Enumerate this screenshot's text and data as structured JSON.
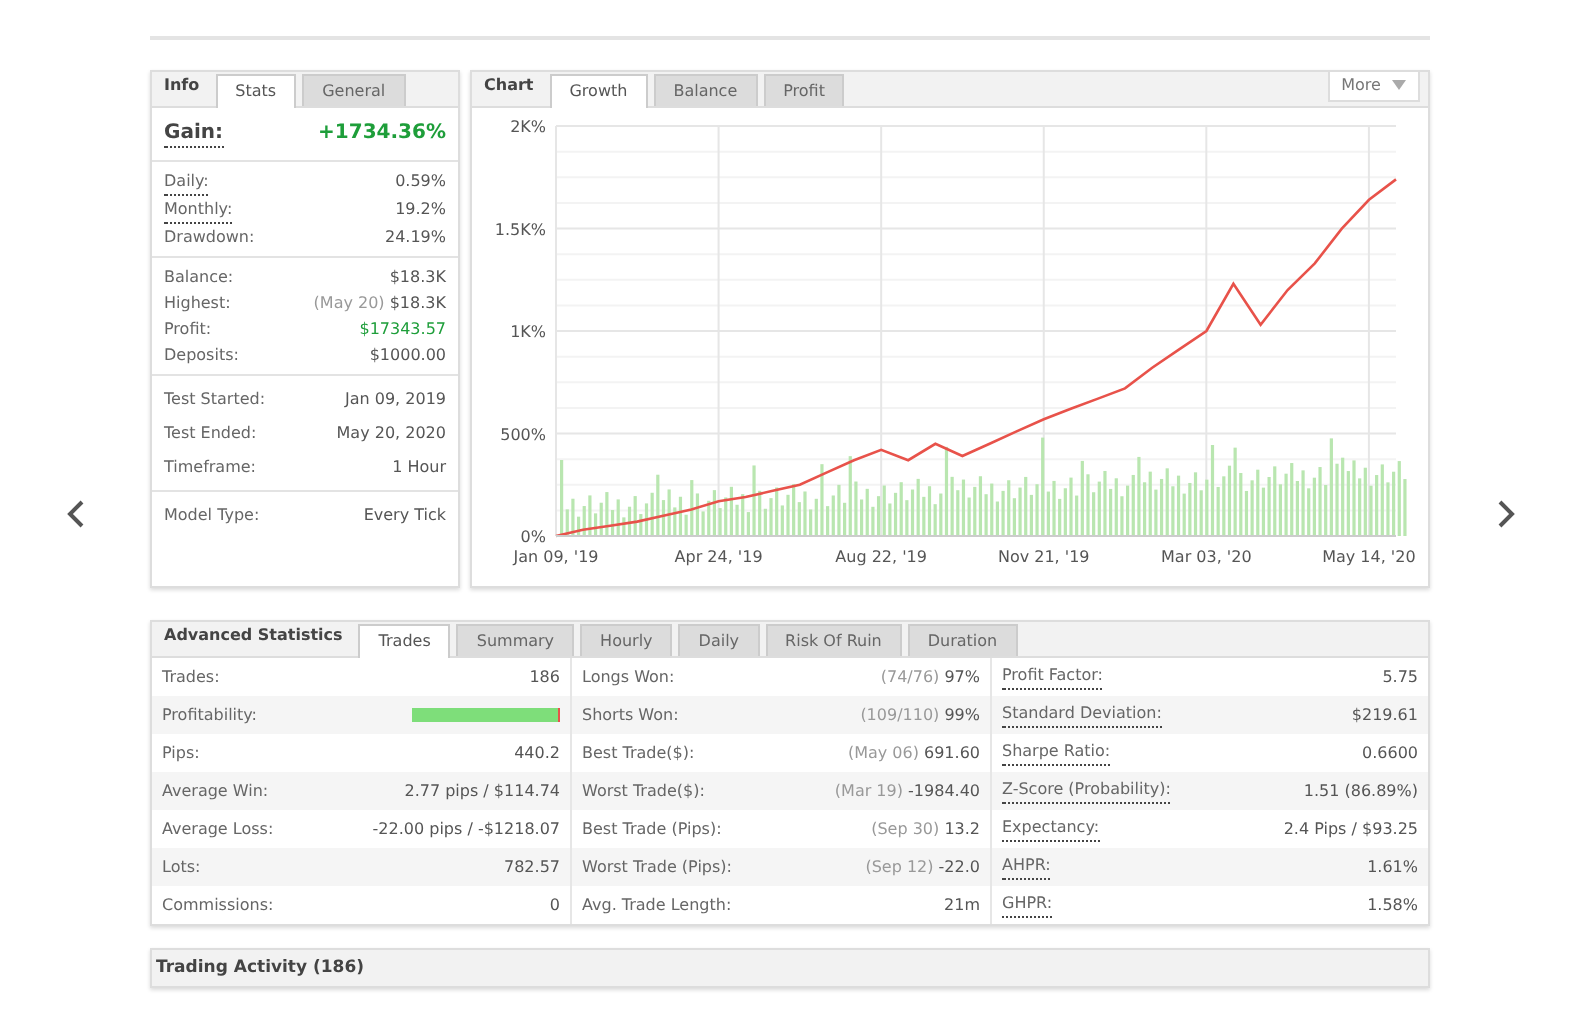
{
  "info": {
    "title": "Info",
    "tabs": [
      {
        "label": "Stats",
        "selected": true
      },
      {
        "label": "General",
        "selected": false
      }
    ],
    "gain": {
      "label": "Gain:",
      "value": "+1734.36%"
    },
    "groups": [
      [
        {
          "label": "Daily:",
          "value": "0.59%",
          "dotted": true,
          "kind": "plain"
        },
        {
          "label": "Monthly:",
          "value": "19.2%",
          "dotted": true,
          "kind": "plain"
        },
        {
          "label": "Drawdown:",
          "value": "24.19%",
          "dotted": false,
          "kind": "plain"
        }
      ],
      [
        {
          "label": "Balance:",
          "value": "$18.3K",
          "dotted": false,
          "kind": "plain"
        },
        {
          "label": "Highest:",
          "note": "(May 20)",
          "value": "$18.3K",
          "dotted": false,
          "kind": "plain"
        },
        {
          "label": "Profit:",
          "value": "$17343.57",
          "dotted": false,
          "kind": "positive"
        },
        {
          "label": "Deposits:",
          "value": "$1000.00",
          "dotted": false,
          "kind": "plain"
        }
      ],
      [
        {
          "label": "Test Started:",
          "value": "Jan 09, 2019",
          "dotted": false,
          "kind": "plain"
        },
        {
          "label": "Test Ended:",
          "value": "May 20, 2020",
          "dotted": false,
          "kind": "plain"
        },
        {
          "label": "Timeframe:",
          "value": "1 Hour",
          "dotted": false,
          "kind": "plain"
        }
      ],
      [
        {
          "label": "Model Type:",
          "value": "Every Tick",
          "dotted": false,
          "kind": "plain"
        }
      ]
    ]
  },
  "chart": {
    "title": "Chart",
    "tabs": [
      {
        "label": "Growth",
        "selected": true
      },
      {
        "label": "Balance",
        "selected": false
      },
      {
        "label": "Profit",
        "selected": false
      }
    ],
    "more": "More",
    "chart_data": {
      "type": "line",
      "grid": true,
      "ylim": [
        0,
        2000
      ],
      "categories": [
        "Jan 09, '19",
        null,
        null,
        null,
        null,
        null,
        "Apr 24, '19",
        null,
        null,
        null,
        null,
        null,
        "Aug 22, '19",
        null,
        null,
        null,
        null,
        null,
        "Nov 21, '19",
        null,
        null,
        null,
        null,
        null,
        "Mar 03, '20",
        null,
        null,
        null,
        null,
        null,
        "May 14, '20",
        null
      ],
      "yticks": [
        {
          "value": 0,
          "label": "0%"
        },
        {
          "value": 500,
          "label": "500%"
        },
        {
          "value": 1000,
          "label": "1K%"
        },
        {
          "value": 1500,
          "label": "1.5K%"
        },
        {
          "value": 2000,
          "label": "2K%"
        }
      ],
      "series": [
        {
          "color": "#e8524a",
          "values": [
            0,
            30,
            50,
            70,
            100,
            130,
            170,
            190,
            220,
            250,
            310,
            370,
            420,
            370,
            450,
            390,
            450,
            510,
            570,
            620,
            670,
            720,
            820,
            910,
            1000,
            1230,
            1030,
            1200,
            1330,
            1500,
            1640,
            1740
          ]
        }
      ]
    }
  },
  "advanced": {
    "title": "Advanced Statistics",
    "tabs": [
      {
        "label": "Trades",
        "selected": true
      },
      {
        "label": "Summary",
        "selected": false
      },
      {
        "label": "Hourly",
        "selected": false
      },
      {
        "label": "Daily",
        "selected": false
      },
      {
        "label": "Risk Of Ruin",
        "selected": false
      },
      {
        "label": "Duration",
        "selected": false
      }
    ],
    "columns": [
      [
        {
          "label": "Trades:",
          "value": "186",
          "kind": "text"
        },
        {
          "label": "Profitability:",
          "kind": "bar",
          "level": 0.984
        },
        {
          "label": "Pips:",
          "value": "440.2",
          "kind": "text"
        },
        {
          "label": "Average Win:",
          "value": "2.77 pips / $114.74",
          "kind": "text"
        },
        {
          "label": "Average Loss:",
          "value": "-22.00 pips / -$1218.07",
          "kind": "text"
        },
        {
          "label": "Lots:",
          "value": "782.57",
          "kind": "text"
        },
        {
          "label": "Commissions:",
          "value": "0",
          "kind": "text"
        }
      ],
      [
        {
          "label": "Longs Won:",
          "note": "(74/76)",
          "value": "97%",
          "kind": "text"
        },
        {
          "label": "Shorts Won:",
          "note": "(109/110)",
          "value": "99%",
          "kind": "text"
        },
        {
          "label": "Best Trade($):",
          "note": "(May 06)",
          "value": "691.60",
          "kind": "text"
        },
        {
          "label": "Worst Trade($):",
          "note": "(Mar 19)",
          "value": "-1984.40",
          "kind": "text"
        },
        {
          "label": "Best Trade (Pips):",
          "note": "(Sep 30)",
          "value": "13.2",
          "kind": "text"
        },
        {
          "label": "Worst Trade (Pips):",
          "note": "(Sep 12)",
          "value": "-22.0",
          "kind": "text"
        },
        {
          "label": "Avg. Trade Length:",
          "value": "21m",
          "kind": "text"
        }
      ],
      [
        {
          "label": "Profit Factor:",
          "value": "5.75",
          "kind": "text",
          "dotted": true
        },
        {
          "label": "Standard Deviation:",
          "value": "$219.61",
          "kind": "text",
          "dotted": true
        },
        {
          "label": "Sharpe Ratio:",
          "value": "0.6600",
          "kind": "text",
          "dotted": true
        },
        {
          "label": "Z-Score (Probability):",
          "value": "1.51 (86.89%)",
          "kind": "text",
          "dotted": true
        },
        {
          "label": "Expectancy:",
          "value": "2.4 Pips / $93.25",
          "kind": "text",
          "dotted": true
        },
        {
          "label": "AHPR:",
          "value": "1.61%",
          "kind": "text",
          "dotted": true
        },
        {
          "label": "GHPR:",
          "value": "1.58%",
          "kind": "text",
          "dotted": true
        }
      ]
    ]
  },
  "activity": {
    "title": "Trading Activity (186)"
  }
}
